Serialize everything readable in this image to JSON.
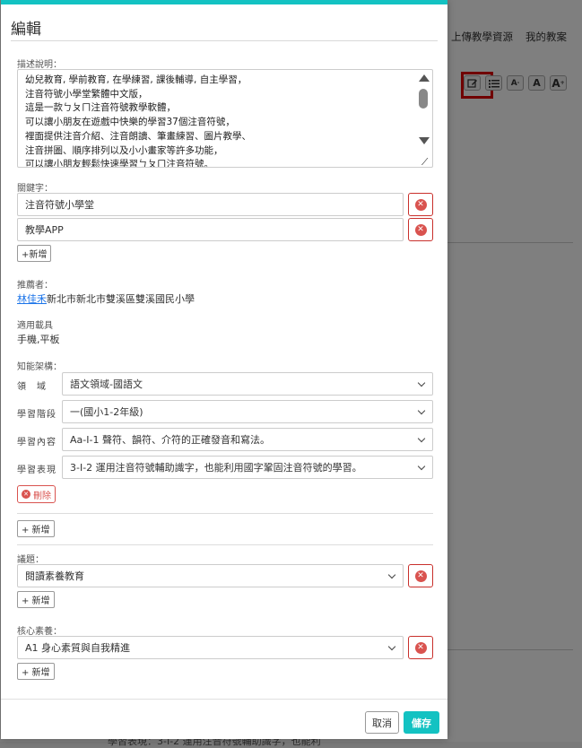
{
  "background": {
    "nav": [
      "上傳教學資源",
      "我的教案"
    ],
    "toolbar_icons": [
      "edit-icon",
      "list-icon",
      "font-decrease-icon",
      "font-normal-icon",
      "font-increase-icon"
    ],
    "toolbar_labels": [
      "A",
      "A",
      "A"
    ],
    "bottom_text": "學習表現：3-Ⅰ-2 運用注音符號輔助識字，也能利"
  },
  "modal": {
    "title": "編輯",
    "description": {
      "label": "描述說明：",
      "lines": [
        "幼兒教育, 學前教育, 在學練習, 課後輔導, 自主學習，",
        "注音符號小學堂繁體中文版，",
        "這是一款ㄅㄆㄇ注音符號教學軟體，",
        "可以讓小朋友在遊戲中快樂的學習37個注音符號，",
        "裡面提供注音介紹、注音朗讀、筆畫練習、圖片教學、",
        "注音拼圖、順序排列以及小小畫家等許多功能，",
        "可以讓小朋友輕鬆快速學習ㄅㄆㄇ注音符號。"
      ]
    },
    "keywords": {
      "label": "關鍵字：",
      "items": [
        "注音符號小學堂",
        "教學APP"
      ],
      "add_label": "+新增"
    },
    "recommender": {
      "label": "推薦者：",
      "name": "林佳禾",
      "org": "新北市新北市雙溪區雙溪國民小學"
    },
    "devices": {
      "label": "適用載具",
      "value": "手機,平板"
    },
    "knowledge": {
      "label": "知能架構：",
      "rows": [
        {
          "label": "領　域",
          "value": "語文領域-國語文"
        },
        {
          "label": "學習階段",
          "value": "一(國小1-2年級)"
        },
        {
          "label": "學習內容",
          "value": "Aa-Ⅰ-1 聲符、韻符、介符的正確發音和寫法。"
        },
        {
          "label": "學習表現",
          "value": "3-Ⅰ-2 運用注音符號輔助識字，也能利用國字鞏固注音符號的學習。"
        }
      ],
      "delete_label": "刪除",
      "add_label": "+ 新增"
    },
    "topic": {
      "label": "議題：",
      "value": "閱讀素養教育",
      "add_label": "+ 新增"
    },
    "core": {
      "label": "核心素養：",
      "value": "A1 身心素質與自我精進",
      "add_label": "+ 新增"
    },
    "footer": {
      "cancel": "取消",
      "save": "儲存"
    }
  },
  "colors": {
    "accent": "#13c2c2",
    "danger": "#d9534f",
    "link": "#1a73e8",
    "highlight": "#e00000"
  }
}
